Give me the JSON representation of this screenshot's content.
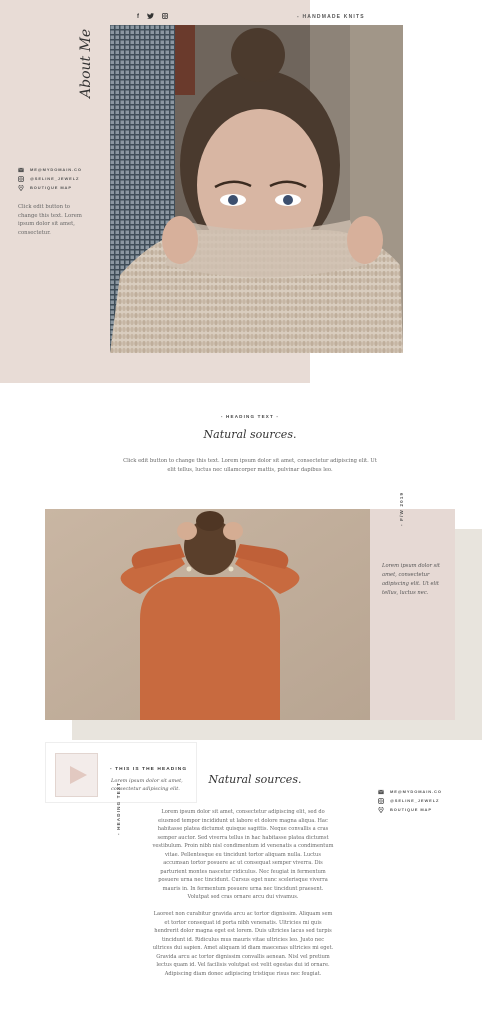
{
  "header": {
    "social": [
      "f",
      "t",
      "i"
    ],
    "tagline": "- HANDMADE KNITS"
  },
  "hero": {
    "title": "About Me",
    "contacts": [
      {
        "icon": "mail-icon",
        "label": "ME@MYDOMAIN.CO"
      },
      {
        "icon": "instagram-icon",
        "label": "@SELINE_JEWELZ"
      },
      {
        "icon": "map-pin-icon",
        "label": "BOUTIQUE MAP"
      }
    ],
    "description": "Click edit button to change this text. Lorem ipsum dolor sit amet, consectetur."
  },
  "section1": {
    "heading": "- HEADING TEXT -",
    "title": "Natural sources.",
    "paragraph": "Click edit button to change this text. Lorem ipsum dolor sit amet, consectetur adipiscing elit. Ut elit tellus, luctus nec ullamcorper mattis, pulvinar dapibus leo."
  },
  "feature": {
    "vertical_label": "- F/W 2019",
    "card_text": "Lorem ipsum dolor sit amet, consectetur adipiscing elit. Ut elit tellus, luctus nec."
  },
  "section2": {
    "video_heading": "- THIS IS THE HEADING",
    "video_desc": "Lorem ipsum dolor sit amet, consectetur adipiscing elit.",
    "vertical_heading": "- HEADING TEXT",
    "title": "Natural sources.",
    "body": [
      "Lorem ipsum dolor sit amet, consectetur adipiscing elit, sed do eiusmod tempor incididunt ut labore et dolore magna aliqua. Hac habitasse platea dictumst quisque sagittis. Neque convallis a cras semper auctor. Sed viverra tellus in hac habitasse platea dictumst vestibulum. Proin nibh nisl condimentum id venenatis a condimentum vitae. Pellentesque eu tincidunt tortor aliquam nulla. Luctus accumsan tortor posuere ac ut consequat semper viverra. Dis parturient montes nascetur ridiculus. Nec feugiat in fermentum posuere urna nec tincidunt. Cursus eget nunc scelerisque viverra mauris in. In fermentum posuere urna nec tincidunt praesent. Volutpat sed cras ornare arcu dui vivamus.",
      "Laoreet non curabitur gravida arcu ac tortor dignissim. Aliquam sem et tortor consequat id porta nibh venenatis. Ultricies mi quis hendrerit dolor magna eget est lorem. Duis ultricies lacus sed turpis tincidunt id. Ridiculus mus mauris vitae ultricies leo. Justo nec ultrices dui sapien. Amet aliquam id diam maecenas ultricies mi eget. Gravida arcu ac tortor dignissim convallis aenean. Nisl vel pretium lectus quam id. Vel facilisis volutpat est velit egestas dui id ornare. Adipiscing diam donec adipiscing tristique risus nec feugiat."
    ],
    "contacts": [
      {
        "icon": "mail-icon",
        "label": "ME@MYDOMAIN.CO"
      },
      {
        "icon": "instagram-icon",
        "label": "@SELINE_JEWELZ"
      },
      {
        "icon": "map-pin-icon",
        "label": "BOUTIQUE MAP"
      }
    ]
  }
}
